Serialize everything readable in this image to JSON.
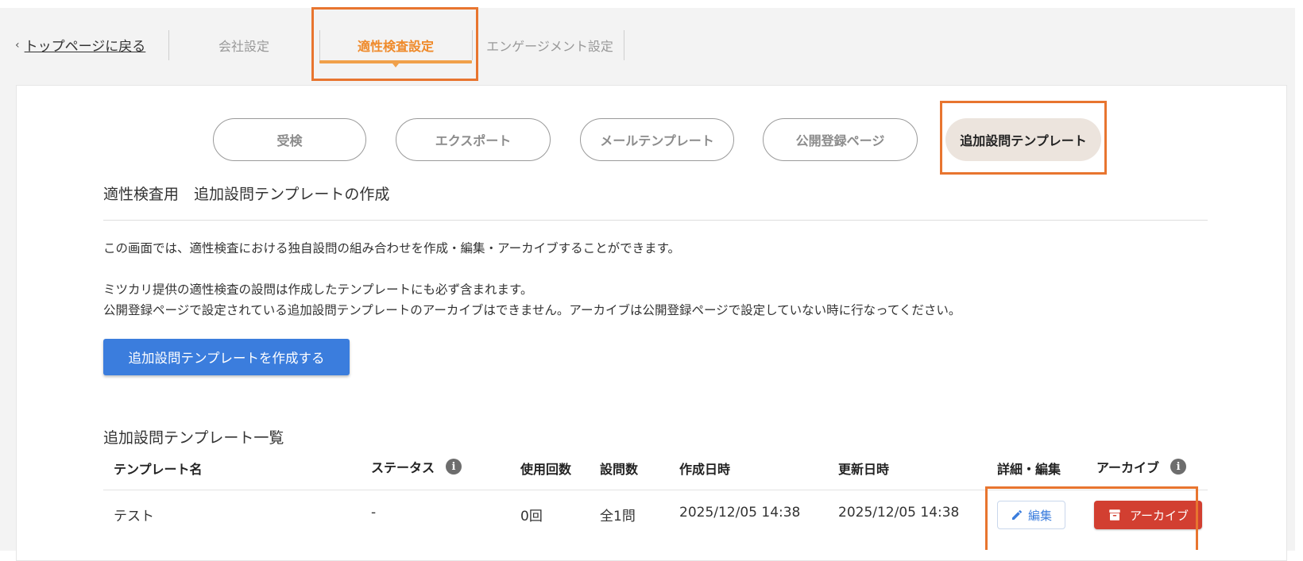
{
  "nav": {
    "back_label": "トップページに戻る",
    "back_chevron": "‹",
    "tabs": [
      {
        "label": "会社設定",
        "active": false
      },
      {
        "label": "適性検査設定",
        "active": true
      },
      {
        "label": "エンゲージメント設定",
        "active": false
      }
    ]
  },
  "subtabs": [
    {
      "label": "受検",
      "active": false
    },
    {
      "label": "エクスポート",
      "active": false
    },
    {
      "label": "メールテンプレート",
      "active": false
    },
    {
      "label": "公開登録ページ",
      "active": false
    },
    {
      "label": "追加設問テンプレート",
      "active": true
    }
  ],
  "page": {
    "title": "適性検査用　追加設問テンプレートの作成",
    "description": [
      "この画面では、適性検査における独自設問の組み合わせを作成・編集・アーカイブすることができます。",
      "ミツカリ提供の適性検査の設問は作成したテンプレートにも必ず含まれます。",
      "公開登録ページで設定されている追加設問テンプレートのアーカイブはできません。アーカイブは公開登録ページで設定していない時に行なってください。"
    ],
    "create_button": "追加設問テンプレートを作成する",
    "list_title": "追加設問テンプレート一覧"
  },
  "table": {
    "headers": {
      "name": "テンプレート名",
      "status": "ステータス",
      "usage": "使用回数",
      "questions": "設問数",
      "created": "作成日時",
      "updated": "更新日時",
      "edit": "詳細・編集",
      "archive": "アーカイブ"
    },
    "rows": [
      {
        "name": "テスト",
        "status": "-",
        "usage": "0回",
        "questions": "全1問",
        "created": "2025/12/05 14:38",
        "updated": "2025/12/05 14:38",
        "edit_label": "編集",
        "archive_label": "アーカイブ"
      }
    ]
  },
  "colors": {
    "accent_orange": "#ef8a2a",
    "highlight_box": "#e8752f",
    "primary_blue": "#3b7ddd",
    "danger_red": "#d23f31",
    "active_pill_bg": "#ece4dd"
  },
  "icons": {
    "info": "info-icon",
    "edit": "pencil-icon",
    "archive": "archive-box-icon"
  }
}
